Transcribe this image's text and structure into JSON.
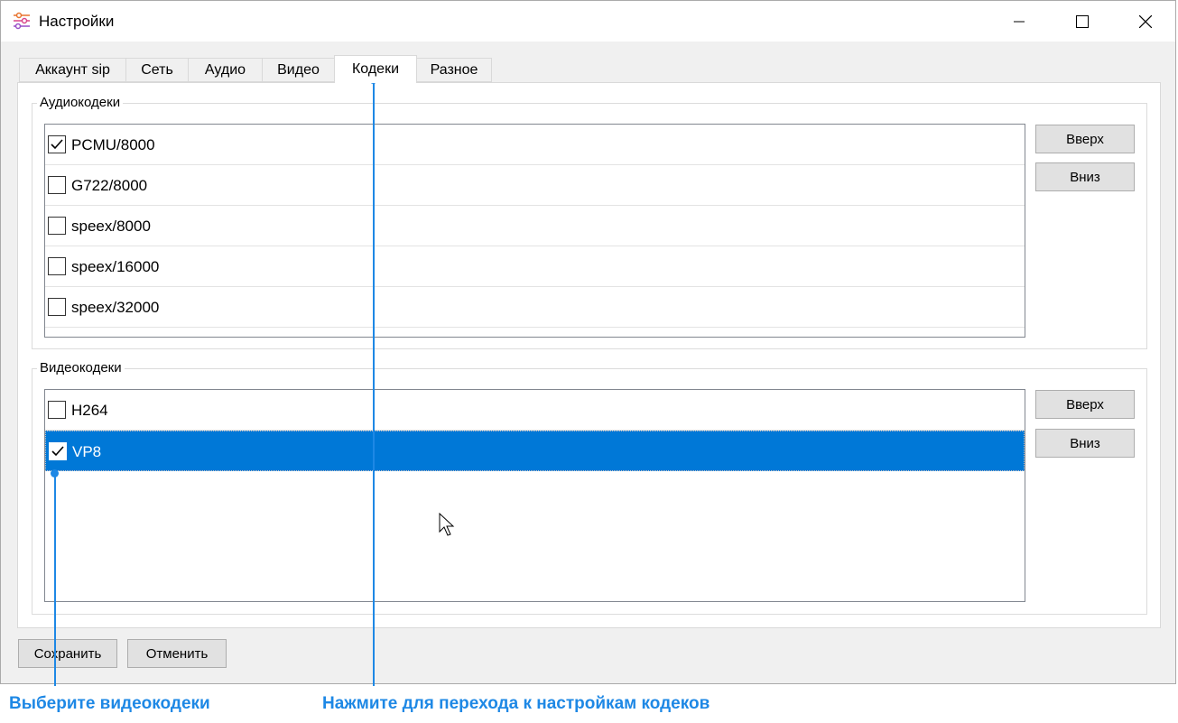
{
  "window": {
    "title": "Настройки",
    "app_icon": "settings-sliders-icon"
  },
  "tabs": [
    {
      "label": "Аккаунт sip",
      "active": false
    },
    {
      "label": "Сеть",
      "active": false
    },
    {
      "label": "Аудио",
      "active": false
    },
    {
      "label": "Видео",
      "active": false
    },
    {
      "label": "Кодеки",
      "active": true
    },
    {
      "label": "Разное",
      "active": false
    }
  ],
  "audio": {
    "group_label": "Аудиокодеки",
    "codecs": [
      {
        "name": "PCMU/8000",
        "checked": true
      },
      {
        "name": "G722/8000",
        "checked": false
      },
      {
        "name": "speex/8000",
        "checked": false
      },
      {
        "name": "speex/16000",
        "checked": false
      },
      {
        "name": "speex/32000",
        "checked": false
      }
    ],
    "up_label": "Вверх",
    "down_label": "Вниз"
  },
  "video": {
    "group_label": "Видеокодеки",
    "codecs": [
      {
        "name": "H264",
        "checked": false
      },
      {
        "name": "VP8",
        "checked": true,
        "selected": true
      }
    ],
    "up_label": "Вверх",
    "down_label": "Вниз"
  },
  "footer": {
    "save_label": "Сохранить",
    "cancel_label": "Отменить"
  },
  "annotations": {
    "video_hint": "Выберите видеокодеки",
    "tab_hint": "Нажмите для перехода к настройкам кодеков"
  },
  "colors": {
    "accent": "#1e88e5",
    "selection": "#0078d7"
  }
}
